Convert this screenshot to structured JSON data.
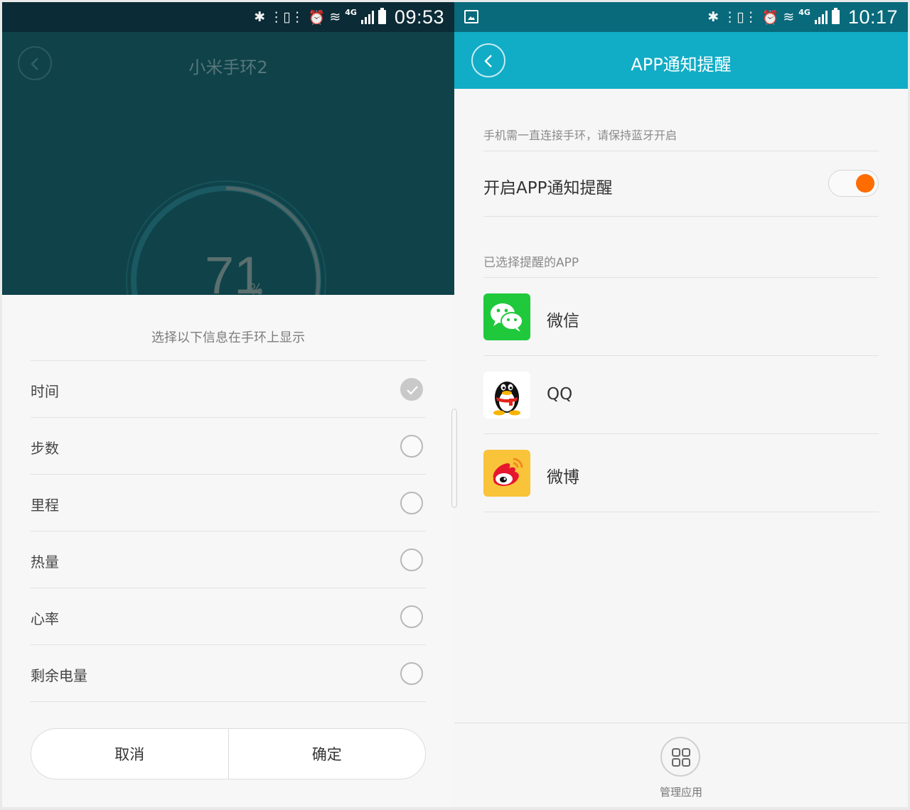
{
  "left_screen": {
    "status_bar": {
      "time": "09:53",
      "network": "4G"
    },
    "header": {
      "title": "小米手环2",
      "battery_percent": "71",
      "percent_sign": "%"
    },
    "sheet": {
      "title": "选择以下信息在手环上显示",
      "options": [
        {
          "label": "时间",
          "checked": true
        },
        {
          "label": "步数",
          "checked": false
        },
        {
          "label": "里程",
          "checked": false
        },
        {
          "label": "热量",
          "checked": false
        },
        {
          "label": "心率",
          "checked": false
        },
        {
          "label": "剩余电量",
          "checked": false
        }
      ],
      "cancel_label": "取消",
      "confirm_label": "确定"
    }
  },
  "right_screen": {
    "status_bar": {
      "time": "10:17",
      "network": "4G"
    },
    "header": {
      "title": "APP通知提醒"
    },
    "hint": "手机需一直连接手环，请保持蓝牙开启",
    "toggle": {
      "label": "开启APP通知提醒",
      "on": true
    },
    "section_title": "已选择提醒的APP",
    "apps": [
      {
        "name": "微信",
        "icon": "wechat-icon",
        "color": "#1fc93b"
      },
      {
        "name": "QQ",
        "icon": "qq-penguin-icon",
        "color": "#ffffff"
      },
      {
        "name": "微博",
        "icon": "weibo-icon",
        "color": "#f9c33a"
      }
    ],
    "bottom": {
      "manage_label": "管理应用"
    }
  },
  "colors": {
    "right_header": "#11acc6",
    "right_statusbar": "#086a7b",
    "left_dim_header": "#0f4249",
    "toggle_knob": "#ff6d00"
  }
}
